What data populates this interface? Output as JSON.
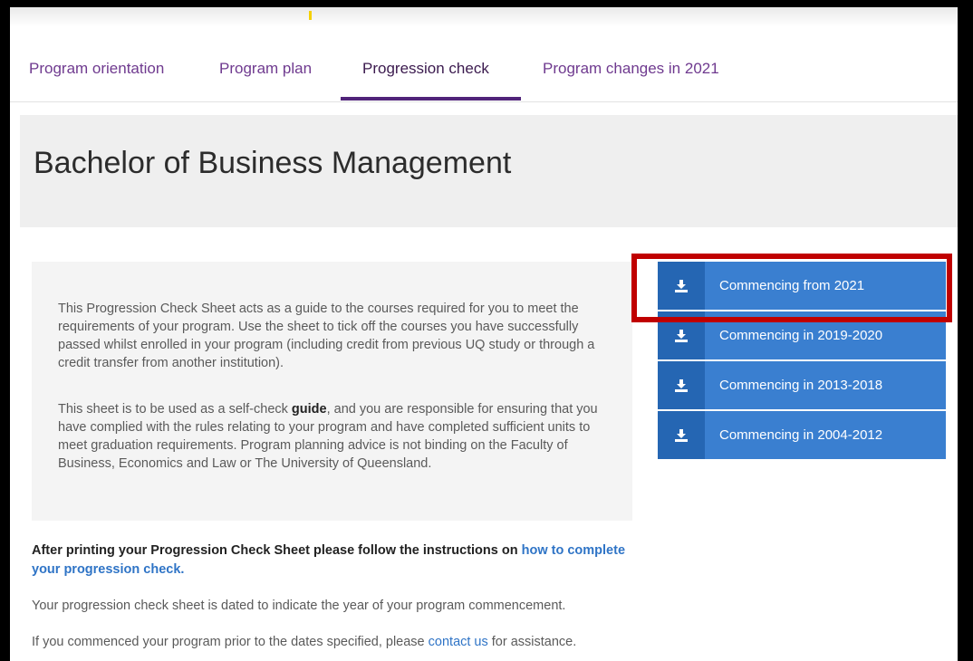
{
  "tabs": [
    {
      "label": "Program orientation"
    },
    {
      "label": "Program plan"
    },
    {
      "label": "Progression check"
    },
    {
      "label": "Program changes in 2021"
    }
  ],
  "active_tab": "Progression check",
  "page_title": "Bachelor of Business Management",
  "intro": {
    "p1": "This Progression Check Sheet acts as a guide to the courses required for you to meet the requirements of your program. Use the sheet to tick off the courses you have successfully passed whilst enrolled in your program (including credit from previous UQ study or through a credit transfer from another institution).",
    "p2_before": "This sheet is to be used as a self-check ",
    "p2_bold": "guide",
    "p2_after": ", and you are responsible for ensuring that you have complied with the rules relating to your program and have completed sufficient units to meet graduation requirements. Program planning advice is not binding on the Faculty of Business, Economics and Law or The University of Queensland."
  },
  "downloads": [
    {
      "label": "Commencing from 2021"
    },
    {
      "label": "Commencing in 2019-2020"
    },
    {
      "label": "Commencing in 2013-2018"
    },
    {
      "label": "Commencing in 2004-2012"
    }
  ],
  "after_print": {
    "text": "After printing your Progression Check Sheet please follow the instructions on ",
    "link": "how to complete your progression check."
  },
  "dated_note": "Your progression check sheet is dated to indicate the year of your program commencement.",
  "contact": {
    "before": "If you commenced your program prior to the dates specified, please ",
    "link": "contact us",
    "after": " for assistance."
  },
  "colors": {
    "tab_text": "#6f3a8f",
    "tab_underline": "#51247a",
    "button_bg": "#3a7fd0",
    "button_icon_bg": "#2566b3",
    "highlight_border": "#c00000",
    "link": "#2f74c6"
  }
}
